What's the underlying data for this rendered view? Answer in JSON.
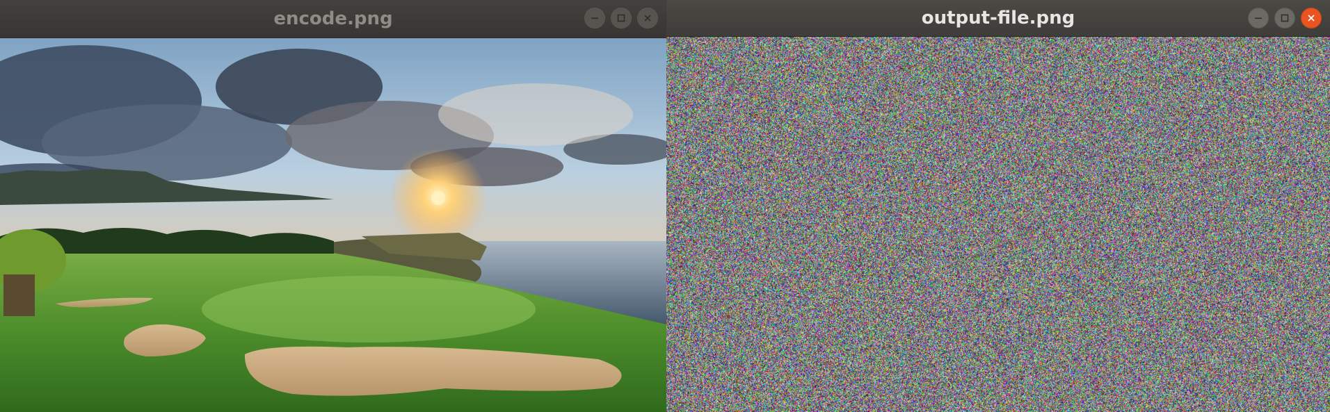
{
  "windows": [
    {
      "title": "encode.png",
      "active": false,
      "controls": {
        "minimize": "minimize-icon",
        "maximize": "maximize-icon",
        "close": "close-icon"
      }
    },
    {
      "title": "output-file.png",
      "active": true,
      "controls": {
        "minimize": "minimize-icon",
        "maximize": "maximize-icon",
        "close": "close-icon"
      }
    }
  ],
  "colors": {
    "titlebar_inactive": "#3a3935",
    "titlebar_active": "#45443f",
    "close_active": "#e95420",
    "title_inactive": "#8e8c86",
    "title_active": "#e8e6e2"
  }
}
